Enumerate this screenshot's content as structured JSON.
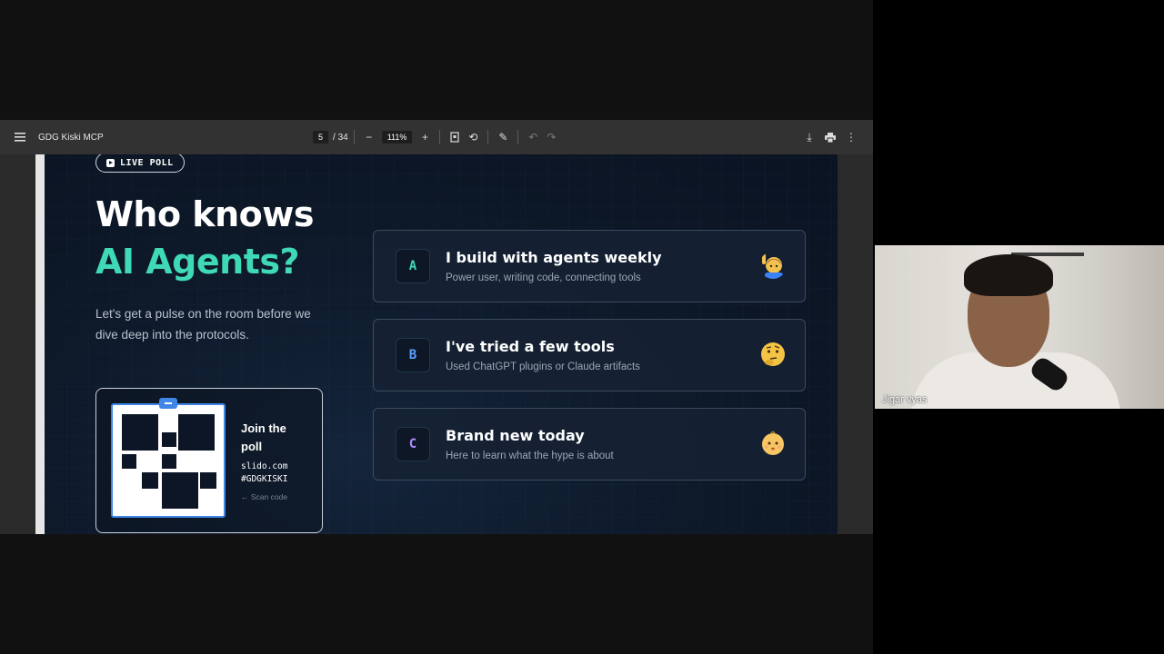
{
  "toolbar": {
    "doc_title": "GDG Kiski MCP",
    "page_current": "5",
    "page_total": "/ 34",
    "zoom": "111%"
  },
  "slide": {
    "badge": "LIVE POLL",
    "title_line1": "Who knows",
    "title_line2": "AI Agents?",
    "subtitle": "Let's get a pulse on the room before we dive deep into the protocols.",
    "qr_card": {
      "join": "Join the poll",
      "url": "slido.com",
      "code": "#GDGKISKI",
      "scan": "Scan code"
    },
    "options": [
      {
        "letter": "A",
        "title": "I build with agents weekly",
        "desc": "Power user, writing code, connecting tools",
        "emoji": "raising-hand-person"
      },
      {
        "letter": "B",
        "title": "I've tried a few tools",
        "desc": "Used ChatGPT plugins or Claude artifacts",
        "emoji": "thinking-face"
      },
      {
        "letter": "C",
        "title": "Brand new today",
        "desc": "Here to learn what the hype is about",
        "emoji": "baby-face"
      }
    ]
  },
  "participant": {
    "name": "Jigar vyas"
  },
  "colors": {
    "accent_teal": "#3fd9b5",
    "accent_blue": "#5aa0ff",
    "accent_purple": "#b58cff"
  }
}
